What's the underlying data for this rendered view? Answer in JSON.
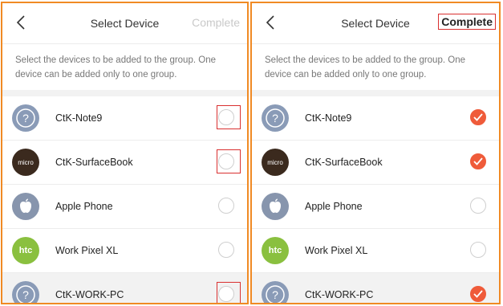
{
  "left": {
    "title": "Select Device",
    "complete_label": "Complete",
    "description": "Select the devices to be added to the group. One device can be added only to one group.",
    "devices": [
      {
        "name": "CtK-Note9",
        "icon": "question-icon",
        "checked": false
      },
      {
        "name": "CtK-SurfaceBook",
        "icon": "micro-logo-icon",
        "icon_text": "micro",
        "checked": false
      },
      {
        "name": "Apple Phone",
        "icon": "apple-icon",
        "checked": false
      },
      {
        "name": "Work Pixel XL",
        "icon": "htc-logo-icon",
        "icon_text": "htc",
        "checked": false
      },
      {
        "name": "CtK-WORK-PC",
        "icon": "question-icon",
        "checked": false
      }
    ]
  },
  "right": {
    "title": "Select Device",
    "complete_label": "Complete",
    "description": "Select the devices to be added to the group. One device can be added only to one group.",
    "devices": [
      {
        "name": "CtK-Note9",
        "icon": "question-icon",
        "checked": true
      },
      {
        "name": "CtK-SurfaceBook",
        "icon": "micro-logo-icon",
        "icon_text": "micro",
        "checked": true
      },
      {
        "name": "Apple Phone",
        "icon": "apple-icon",
        "checked": false
      },
      {
        "name": "Work Pixel XL",
        "icon": "htc-logo-icon",
        "icon_text": "htc",
        "checked": false
      },
      {
        "name": "CtK-WORK-PC",
        "icon": "question-icon",
        "checked": true
      }
    ]
  },
  "colors": {
    "frame": "#f08a24",
    "highlight": "#d93030",
    "checked": "#ef5b3a"
  }
}
